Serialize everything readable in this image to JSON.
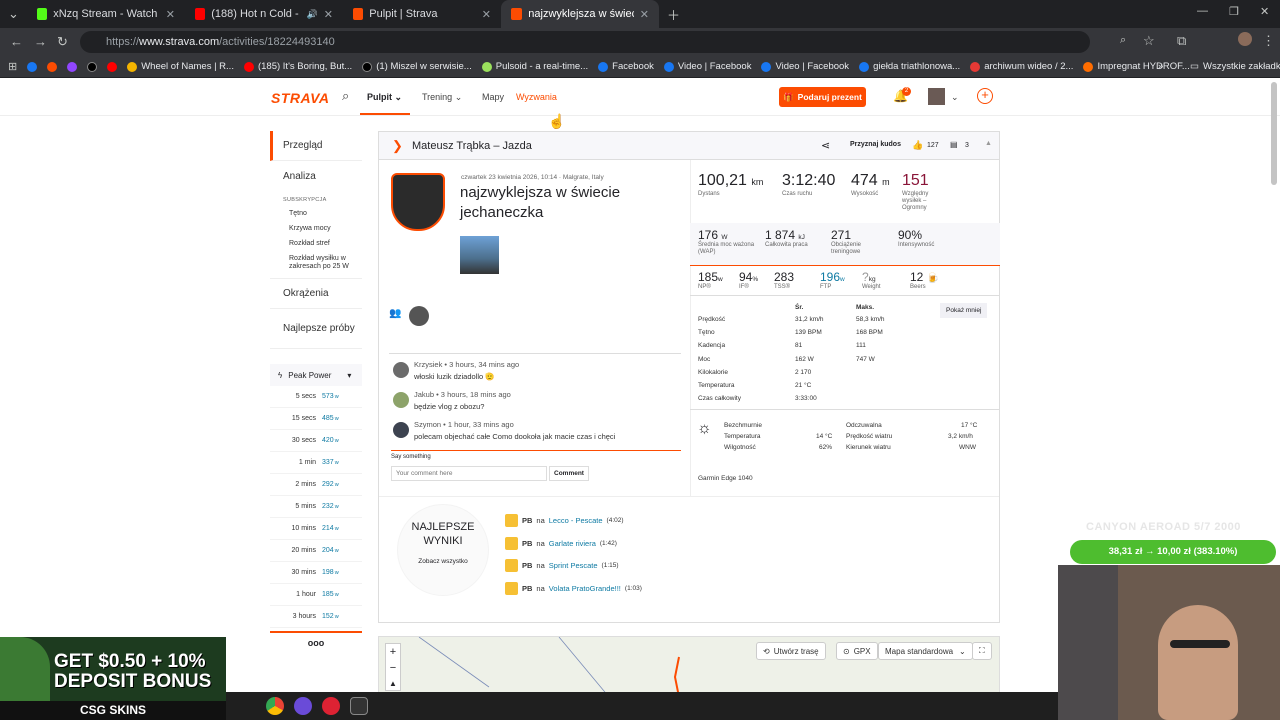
{
  "browser": {
    "tabs": [
      {
        "title": "xNzq Stream - Watch Live on K",
        "color": "#53fc18"
      },
      {
        "title": "(188) Hot n Cold - Agartha",
        "color": "#ff0000"
      },
      {
        "title": "Pulpit | Strava",
        "color": "#fc4c02"
      },
      {
        "title": "najzwyklejsza w świecie jechane",
        "color": "#fc4c02"
      }
    ],
    "url_prefix": "https://",
    "url_host": "www.strava.com",
    "url_path": "/activities/18224493140",
    "bookmarks": [
      "Wheel of Names | R...",
      "(185) It's Boring, But...",
      "(1) Miszel w serwisie...",
      "Pulsoid - a real-time...",
      "Facebook",
      "Video | Facebook",
      "Video | Facebook",
      "giełda triathlonowa...",
      "archiwum wideo / 2...",
      "Impregnat HYDROF..."
    ],
    "all_bookmarks": "Wszystkie zakładki"
  },
  "nav": {
    "logo": "STRAVA",
    "items": [
      "Pulpit",
      "Trening",
      "Mapy",
      "Wyzwania"
    ],
    "gift": "Podaruj prezent",
    "notif_count": "2"
  },
  "sidebar": {
    "overview": "Przegląd",
    "analysis": "Analiza",
    "sub_head": "SUBSKRYPCJA",
    "sub_items": [
      "Tętno",
      "Krzywa mocy",
      "Rozkład stref",
      "Rozkład wysiłku w zakresach po 25 W"
    ],
    "laps": "Okrążenia",
    "best": "Najlepsze próby",
    "peak_title": "Peak Power",
    "peak": [
      {
        "k": "5 secs",
        "v": "573"
      },
      {
        "k": "15 secs",
        "v": "485"
      },
      {
        "k": "30 secs",
        "v": "420"
      },
      {
        "k": "1 min",
        "v": "337"
      },
      {
        "k": "2 mins",
        "v": "292"
      },
      {
        "k": "5 mins",
        "v": "232"
      },
      {
        "k": "10 mins",
        "v": "214"
      },
      {
        "k": "20 mins",
        "v": "204"
      },
      {
        "k": "30 mins",
        "v": "198"
      },
      {
        "k": "1 hour",
        "v": "185"
      },
      {
        "k": "3 hours",
        "v": "152"
      }
    ],
    "peak_unit": "w",
    "more": "ooo"
  },
  "activity": {
    "header": "Mateusz Trąbka – Jazda",
    "kudos_btn": "Przyznaj kudos",
    "kudos": "127",
    "comments": "3",
    "date": "czwartek 23 kwietnia 2026, 10:14 · Malgrate, Italy",
    "title": "najzwyklejsza w świecie jechaneczka"
  },
  "stats": {
    "distance": "100,21",
    "distance_unit": "km",
    "distance_label": "Dystans",
    "time": "3:12:40",
    "time_label": "Czas ruchu",
    "elev": "474",
    "elev_unit": "m",
    "elev_label": "Wysokość",
    "rel": "151",
    "rel_label": "Względny wysiłek – Ogromny",
    "wap": "176",
    "wap_unit": "W",
    "wap_label": "Średnia moc ważona (WAP)",
    "work": "1 874",
    "work_unit": "kJ",
    "work_label": "Całkowita praca",
    "load": "271",
    "load_label": "Obciążenie treningowe",
    "intensity": "90%",
    "intensity_label": "Intensywność",
    "np": "185",
    "np_u": "w",
    "np_l": "NP®",
    "if": "94",
    "if_u": "%",
    "if_l": "IF®",
    "tss": "283",
    "tss_l": "TSS®",
    "ftp": "196",
    "ftp_u": "w",
    "ftp_l": "FTP",
    "weight": "?",
    "weight_u": "kg",
    "weight_l": "Weight",
    "beers": "12",
    "beers_l": "Beers"
  },
  "table": {
    "h_avg": "Śr.",
    "h_max": "Maks.",
    "less": "Pokaż mniej",
    "rows": [
      {
        "k": "Prędkość",
        "a": "31,2 km/h",
        "m": "58,3 km/h"
      },
      {
        "k": "Tętno",
        "a": "139 BPM",
        "m": "168 BPM"
      },
      {
        "k": "Kadencja",
        "a": "81",
        "m": "111"
      },
      {
        "k": "Moc",
        "a": "162 W",
        "m": "747 W"
      },
      {
        "k": "Kilokalorie",
        "a": "2 170",
        "m": ""
      },
      {
        "k": "Temperatura",
        "a": "21 °C",
        "m": ""
      },
      {
        "k": "Czas całkowity",
        "a": "3:33:00",
        "m": ""
      }
    ]
  },
  "weather": {
    "cond": "Bezchmurnie",
    "temp_l": "Temperatura",
    "temp": "14 °C",
    "hum_l": "Wilgotność",
    "hum": "62%",
    "feel_l": "Odczuwalna",
    "feel": "17 °C",
    "wind_l": "Prędkość wiatru",
    "wind": "3,2 km/h",
    "dir_l": "Kierunek wiatru",
    "dir": "WNW"
  },
  "device": "Garmin Edge 1040",
  "comments": [
    {
      "name": "Krzysiek",
      "time": " • 3 hours, 34 mins ago",
      "text": "włoski luzik dziadollo 🫡"
    },
    {
      "name": "Jakub",
      "time": " • 3 hours, 18 mins ago",
      "text": "będzie vlog z obozu?"
    },
    {
      "name": "Szymon",
      "time": " • 1 hour, 33 mins ago",
      "text": "polecam objechać całe Como dookoła jak macie czas i chęci"
    }
  ],
  "comment_form": {
    "label": "Say something",
    "placeholder": "Your comment here",
    "btn": "Comment"
  },
  "best": {
    "title": "NAJLEPSZE WYNIKI",
    "see_all": "Zobacz wszystko",
    "items": [
      {
        "pb": "PB",
        "na": "na",
        "seg": "Lecco - Pescate",
        "t": "(4:02)"
      },
      {
        "pb": "PB",
        "na": "na",
        "seg": "Garlate riviera",
        "t": "(1:42)"
      },
      {
        "pb": "PB",
        "na": "na",
        "seg": "Sprint Pescate",
        "t": "(1:15)"
      },
      {
        "pb": "PB",
        "na": "na",
        "seg": "Volata PratoGrande!!!",
        "t": "(1:03)"
      }
    ]
  },
  "map": {
    "route": "Utwórz trasę",
    "gpx": "GPX",
    "style": "Mapa standardowa"
  },
  "overlay": {
    "ad1": "GET $0.50 + 10%",
    "ad2": "DEPOSIT BONUS",
    "ad3": "CSG SKINS",
    "bike": "CANYON AEROAD 5/7 2000",
    "price": "38,31 zł → 10,00 zł (383.10%)"
  }
}
